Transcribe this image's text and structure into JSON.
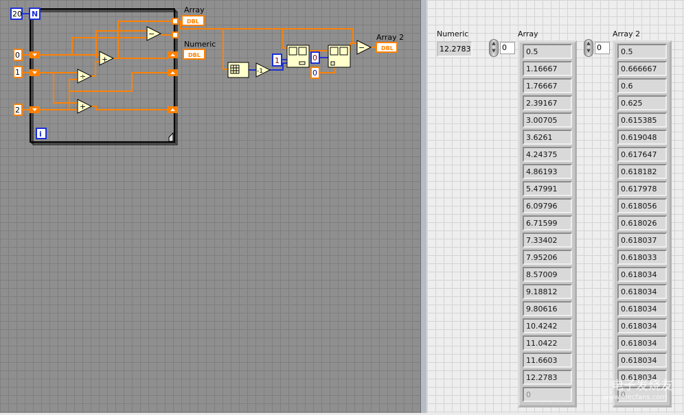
{
  "block_diagram": {
    "loop_count": "20",
    "count_terminal": "N",
    "iteration_terminal": "i",
    "constants": {
      "init0": "0",
      "init1": "1",
      "init2": "2",
      "index_one": "1",
      "index_zero": "0",
      "length_zero": "0"
    },
    "nodes": {
      "add1": "+",
      "add2": "+",
      "divide": "÷",
      "subtract": "−",
      "subtract2": "−",
      "decrement": "-1"
    },
    "indicators": [
      {
        "label": "Array",
        "type": "DBL"
      },
      {
        "label": "Numeric",
        "type": "DBL"
      },
      {
        "label": "Array 2",
        "type": "DBL"
      }
    ],
    "wire_color": "#ff8000"
  },
  "front_panel": {
    "numeric": {
      "label": "Numeric",
      "value": "12.2783"
    },
    "array": {
      "label": "Array",
      "index": "0",
      "values": [
        "0.5",
        "1.16667",
        "1.76667",
        "2.39167",
        "3.00705",
        "3.6261",
        "4.24375",
        "4.86193",
        "5.47991",
        "6.09796",
        "6.71599",
        "7.33402",
        "7.95206",
        "8.57009",
        "9.18812",
        "9.80616",
        "10.4242",
        "11.0422",
        "11.6603",
        "12.2783"
      ],
      "empty": "0"
    },
    "array2": {
      "label": "Array 2",
      "index": "0",
      "values": [
        "0.5",
        "0.666667",
        "0.6",
        "0.625",
        "0.615385",
        "0.619048",
        "0.617647",
        "0.618182",
        "0.617978",
        "0.618056",
        "0.618026",
        "0.618037",
        "0.618033",
        "0.618034",
        "0.618034",
        "0.618034",
        "0.618034",
        "0.618034",
        "0.618034",
        "0.618034"
      ],
      "empty": "0"
    }
  },
  "watermark": {
    "text": "电子发烧友",
    "url": "www.elecfans.com"
  }
}
